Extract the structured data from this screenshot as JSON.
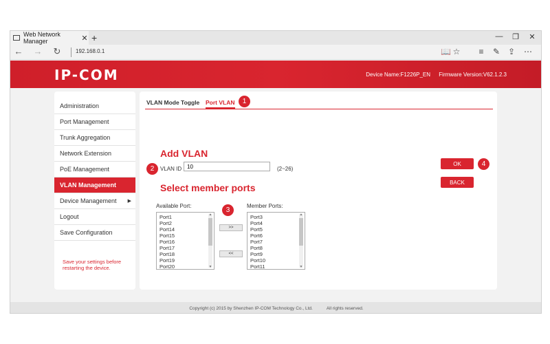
{
  "browser": {
    "tab_title": "Web Network Manager",
    "tab_close": "✕",
    "new_tab": "+",
    "url": "192.168.0.1",
    "window_controls": {
      "minimize": "—",
      "restore": "❐",
      "close": "✕"
    },
    "nav": {
      "back": "←",
      "forward": "→",
      "refresh": "↻"
    },
    "tools": {
      "reading": "📖",
      "favorite": "☆",
      "hub": "≡",
      "note": "✎",
      "share": "⇪",
      "more": "⋯"
    }
  },
  "header": {
    "logo": "IP-COM",
    "device_name": "Device Name:F1226P_EN",
    "firmware": "Firmware Version:V62.1.2.3"
  },
  "sidebar": {
    "items": [
      {
        "label": "Administration"
      },
      {
        "label": "Port Management"
      },
      {
        "label": "Trunk Aggregation"
      },
      {
        "label": "Network Extension"
      },
      {
        "label": "PoE Management"
      },
      {
        "label": "VLAN Management",
        "active": true
      },
      {
        "label": "Device Management",
        "arrow": "▶"
      },
      {
        "label": "Logout"
      },
      {
        "label": "Save Configuration"
      }
    ],
    "note": "Save your settings before restarting the device."
  },
  "content": {
    "tabs": [
      {
        "label": "VLAN Mode Toggle"
      },
      {
        "label": "Port VLAN",
        "active": true
      }
    ],
    "add_vlan_title": "Add VLAN",
    "vlan_id_label": "VLAN ID",
    "vlan_id_value": "10",
    "vlan_id_range": "(2~26)",
    "member_ports_title": "Select member ports",
    "available_label": "Available Port:",
    "member_label": "Member Ports:",
    "available_ports": [
      "Port1",
      "Port2",
      "Port14",
      "Port15",
      "Port16",
      "Port17",
      "Port18",
      "Port19",
      "Port20"
    ],
    "member_ports": [
      "Port3",
      "Port4",
      "Port5",
      "Port6",
      "Port7",
      "Port8",
      "Port9",
      "Port10",
      "Port11"
    ],
    "add_button": ">>",
    "remove_button": "<<",
    "ok_button": "OK",
    "back_button": "BACK",
    "markers": [
      "1",
      "2",
      "3",
      "4"
    ]
  },
  "footer": {
    "copyright": "Copyright (c) 2015 by Shenzhen IP-COM Technology Co., Ltd.",
    "rights": "All rights reserved."
  },
  "colors": {
    "brand_red": "#d9252f",
    "background": "#f2f2f2"
  }
}
